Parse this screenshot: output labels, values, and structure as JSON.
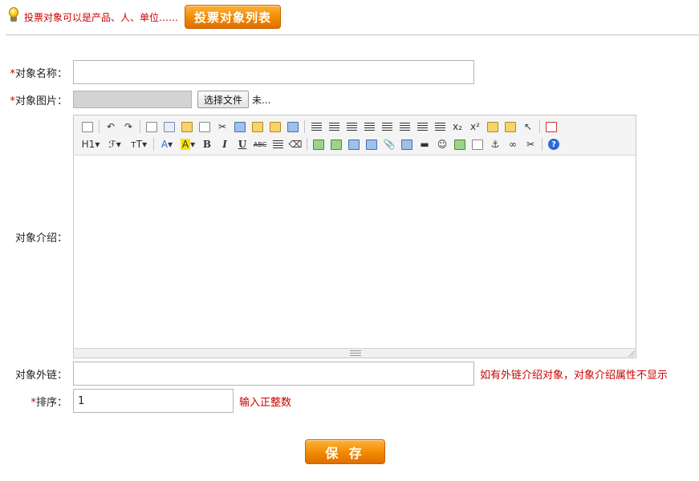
{
  "hint": {
    "text": "投票对象可以是产品、人、单位……",
    "list_button": "投票对象列表"
  },
  "form": {
    "required_mark": "*",
    "name_label": "对象名称：",
    "name_value": "",
    "image_label": "对象图片：",
    "file_button": "选择文件",
    "file_status": "未...",
    "intro_label": "对象介绍：",
    "link_label": "对象外链：",
    "link_value": "",
    "link_note": "如有外链介绍对象，对象介绍属性不显示",
    "order_label": "排序：",
    "order_value": "1",
    "order_note": "输入正整数",
    "save_button": "保 存"
  },
  "editor": {
    "heading_label": "H1",
    "font_family_label": "ℱ",
    "font_size_label": "ᴛT",
    "font_color_label": "A",
    "bg_color_label": "A",
    "bold": "B",
    "italic": "I",
    "underline": "U",
    "strike": "ABC",
    "subscript": "x₂",
    "superscript": "x²",
    "help": "?"
  },
  "colors": {
    "accent_orange": "#f08a00",
    "note_red": "#cc0000"
  }
}
